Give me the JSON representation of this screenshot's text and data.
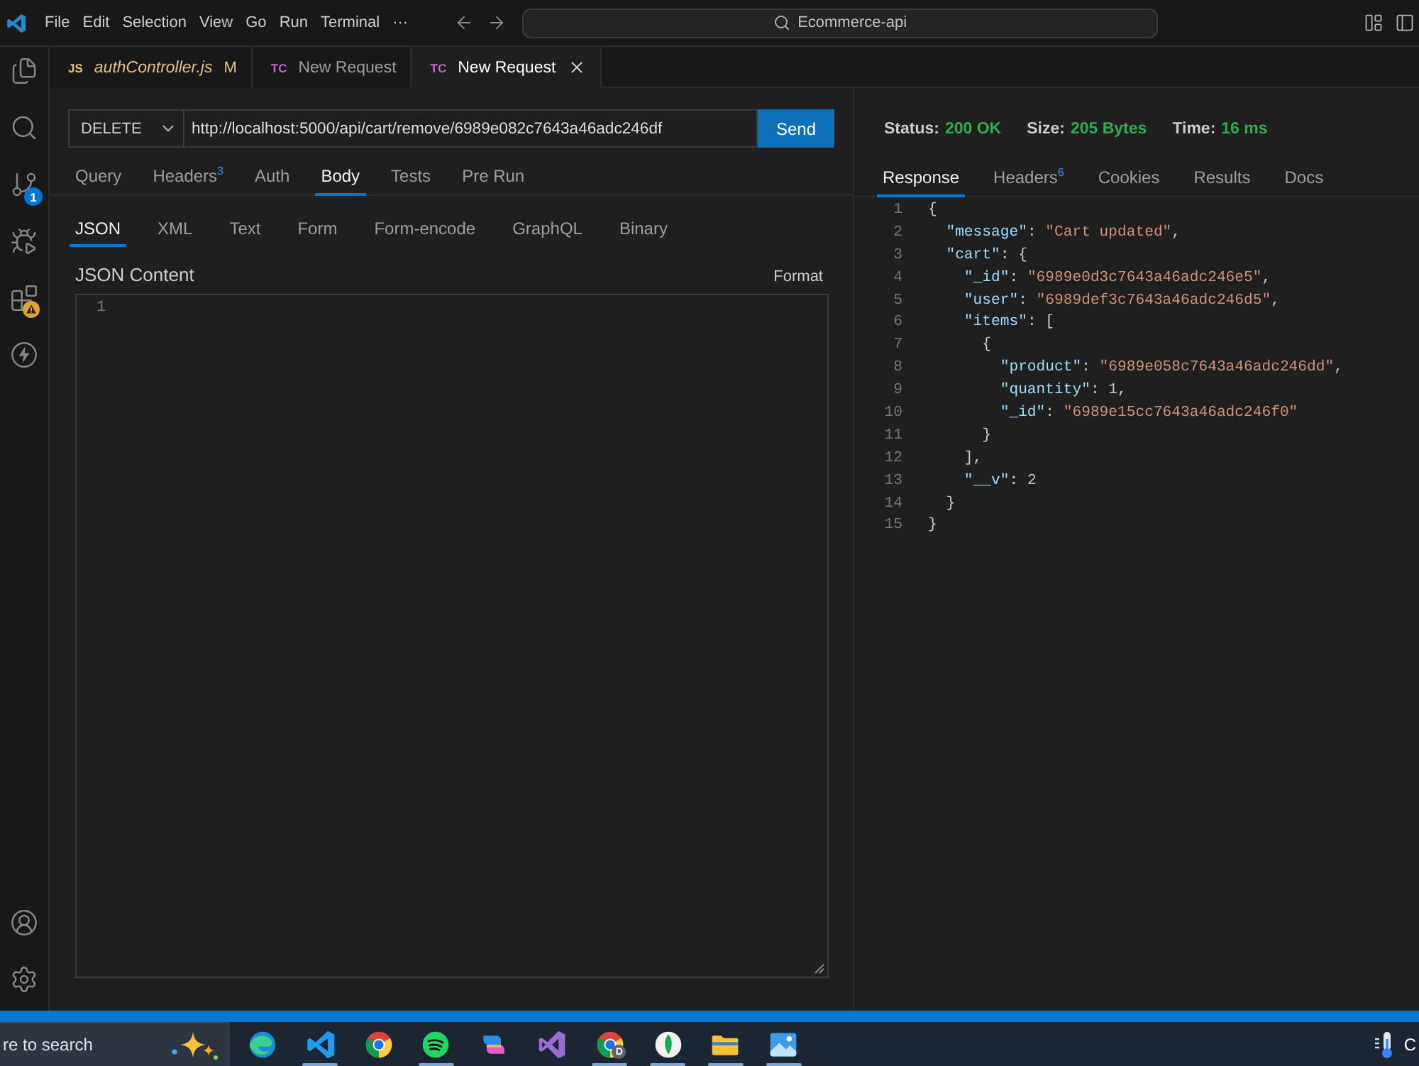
{
  "title_bar": {
    "menu": [
      "File",
      "Edit",
      "Selection",
      "View",
      "Go",
      "Run",
      "Terminal",
      "···"
    ],
    "command_center": "Ecommerce-api"
  },
  "activity_bar": {
    "top": [
      {
        "kind": "explorer"
      },
      {
        "kind": "search"
      },
      {
        "kind": "source_control",
        "badge": "1"
      },
      {
        "kind": "run_debug"
      },
      {
        "kind": "extensions",
        "warning": true
      },
      {
        "kind": "thunder"
      }
    ],
    "bottom": [
      {
        "kind": "account"
      },
      {
        "kind": "settings"
      }
    ]
  },
  "editor_tabs": [
    {
      "file_icon": "JS",
      "color": "#e5c07b",
      "label": "authController.js",
      "preview": true,
      "git_status": "M",
      "selected": false
    },
    {
      "file_icon": "TC",
      "color": "#c066c8",
      "label": "New Request",
      "preview": false,
      "selected": false
    },
    {
      "file_icon": "TC",
      "color": "#c066c8",
      "label": "New Request",
      "preview": false,
      "selected": true
    }
  ],
  "request": {
    "method": "DELETE",
    "url": "http://localhost:5000/api/cart/remove/6989e082c7643a46adc246df",
    "send_label": "Send",
    "tabs": [
      {
        "label": "Query",
        "selected": false
      },
      {
        "label": "Headers$^{3}$",
        "selected": false
      },
      {
        "label": "Auth",
        "selected": false
      },
      {
        "label": "Body",
        "selected": true
      },
      {
        "label": "Tests",
        "selected": false
      },
      {
        "label": "Pre Run",
        "selected": false
      }
    ],
    "body_types": [
      {
        "label": "JSON",
        "selected": true
      },
      {
        "label": "XML",
        "selected": false
      },
      {
        "label": "Text",
        "selected": false
      },
      {
        "label": "Form",
        "selected": false
      },
      {
        "label": "Form-encode",
        "selected": false
      },
      {
        "label": "GraphQL",
        "selected": false
      },
      {
        "label": "Binary",
        "selected": false
      }
    ],
    "content_label": "JSON Content",
    "format_label": "Format",
    "editor_line_numbers": [
      "1"
    ]
  },
  "response": {
    "stats": [
      {
        "label": "Status:",
        "value": "200 OK"
      },
      {
        "label": "Size:",
        "value": "205 Bytes"
      },
      {
        "label": "Time:",
        "value": "16 ms"
      }
    ],
    "tabs": [
      {
        "label": "Response",
        "selected": true
      },
      {
        "label": "Headers$^{6}$",
        "selected": false
      },
      {
        "label": "Cookies",
        "selected": false
      },
      {
        "label": "Results",
        "selected": false
      },
      {
        "label": "Docs",
        "selected": false
      }
    ],
    "lines": [
      {
        "number": "1",
        "tokens": [
          {
            "kind": "punct",
            "text": "{"
          }
        ]
      },
      {
        "number": "2",
        "tokens": [
          {
            "kind": "key",
            "text": "  \"message\""
          },
          {
            "kind": "punct",
            "text": ": "
          },
          {
            "kind": "string",
            "text": "\"Cart updated\""
          },
          {
            "kind": "punct",
            "text": ","
          }
        ]
      },
      {
        "number": "3",
        "tokens": [
          {
            "kind": "key",
            "text": "  \"cart\""
          },
          {
            "kind": "punct",
            "text": ": {"
          }
        ]
      },
      {
        "number": "4",
        "tokens": [
          {
            "kind": "key",
            "text": "    \"_id\""
          },
          {
            "kind": "punct",
            "text": ": "
          },
          {
            "kind": "string",
            "text": "\"6989e0d3c7643a46adc246e5\""
          },
          {
            "kind": "punct",
            "text": ","
          }
        ]
      },
      {
        "number": "5",
        "tokens": [
          {
            "kind": "key",
            "text": "    \"user\""
          },
          {
            "kind": "punct",
            "text": ": "
          },
          {
            "kind": "string",
            "text": "\"6989def3c7643a46adc246d5\""
          },
          {
            "kind": "punct",
            "text": ","
          }
        ]
      },
      {
        "number": "6",
        "tokens": [
          {
            "kind": "key",
            "text": "    \"items\""
          },
          {
            "kind": "punct",
            "text": ": ["
          }
        ]
      },
      {
        "number": "7",
        "tokens": [
          {
            "kind": "punct",
            "text": "      {"
          }
        ]
      },
      {
        "number": "8",
        "tokens": [
          {
            "kind": "key",
            "text": "        \"product\""
          },
          {
            "kind": "punct",
            "text": ": "
          },
          {
            "kind": "string",
            "text": "\"6989e058c7643a46adc246dd\""
          },
          {
            "kind": "punct",
            "text": ","
          }
        ]
      },
      {
        "number": "9",
        "tokens": [
          {
            "kind": "key",
            "text": "        \"quantity\""
          },
          {
            "kind": "punct",
            "text": ": "
          },
          {
            "kind": "number",
            "text": "1"
          },
          {
            "kind": "punct",
            "text": ","
          }
        ]
      },
      {
        "number": "10",
        "tokens": [
          {
            "kind": "key",
            "text": "        \"_id\""
          },
          {
            "kind": "punct",
            "text": ": "
          },
          {
            "kind": "string",
            "text": "\"6989e15cc7643a46adc246f0\""
          }
        ]
      },
      {
        "number": "11",
        "tokens": [
          {
            "kind": "punct",
            "text": "      }"
          }
        ]
      },
      {
        "number": "12",
        "tokens": [
          {
            "kind": "punct",
            "text": "    ],"
          }
        ]
      },
      {
        "number": "13",
        "tokens": [
          {
            "kind": "key",
            "text": "    \"__v\""
          },
          {
            "kind": "punct",
            "text": ": "
          },
          {
            "kind": "number",
            "text": "2"
          }
        ]
      },
      {
        "number": "14",
        "tokens": [
          {
            "kind": "punct",
            "text": "  }"
          }
        ]
      },
      {
        "number": "15",
        "tokens": [
          {
            "kind": "punct",
            "text": "}"
          }
        ]
      }
    ]
  },
  "taskbar": {
    "search": {
      "placeholder": "re to search"
    },
    "apps": [
      {
        "kind": "edge",
        "running": false
      },
      {
        "kind": "vscode",
        "running": true
      },
      {
        "kind": "chrome",
        "running": false
      },
      {
        "kind": "spotify",
        "running": true
      },
      {
        "kind": "copilot",
        "running": false
      },
      {
        "kind": "visual_studio",
        "running": false
      },
      {
        "kind": "chrome",
        "badge": "D",
        "running": true
      },
      {
        "kind": "compass",
        "running": true
      },
      {
        "kind": "folder",
        "running": true
      },
      {
        "kind": "photos",
        "running": true
      }
    ],
    "tray_text": "C"
  }
}
